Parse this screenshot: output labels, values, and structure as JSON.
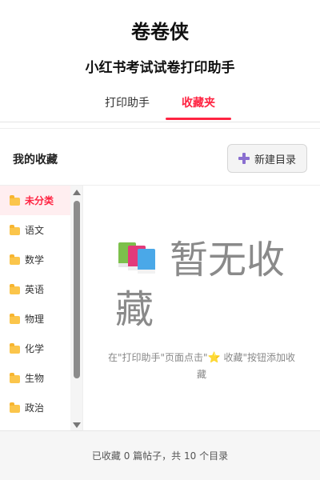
{
  "app_title": "卷卷侠",
  "subtitle": "小红书考试试卷打印助手",
  "tabs": [
    {
      "label": "打印助手",
      "active": false
    },
    {
      "label": "收藏夹",
      "active": true
    }
  ],
  "accent_color": "#ff2442",
  "favorites": {
    "label": "我的收藏",
    "new_folder_label": "新建目录",
    "new_folder_icon": "plus-icon"
  },
  "folders": [
    {
      "label": "未分类",
      "active": true
    },
    {
      "label": "语文"
    },
    {
      "label": "数学"
    },
    {
      "label": "英语"
    },
    {
      "label": "物理"
    },
    {
      "label": "化学"
    },
    {
      "label": "生物"
    },
    {
      "label": "政治"
    }
  ],
  "empty_state": {
    "icon": "books-icon",
    "title": "暂无收藏",
    "hint_part1": "在\"打印助手\"页面点击\"",
    "hint_star": "⭐",
    "hint_part2": " 收藏\"按钮添加收藏"
  },
  "footer_text": "已收藏 0 篇帖子，共 10 个目录"
}
